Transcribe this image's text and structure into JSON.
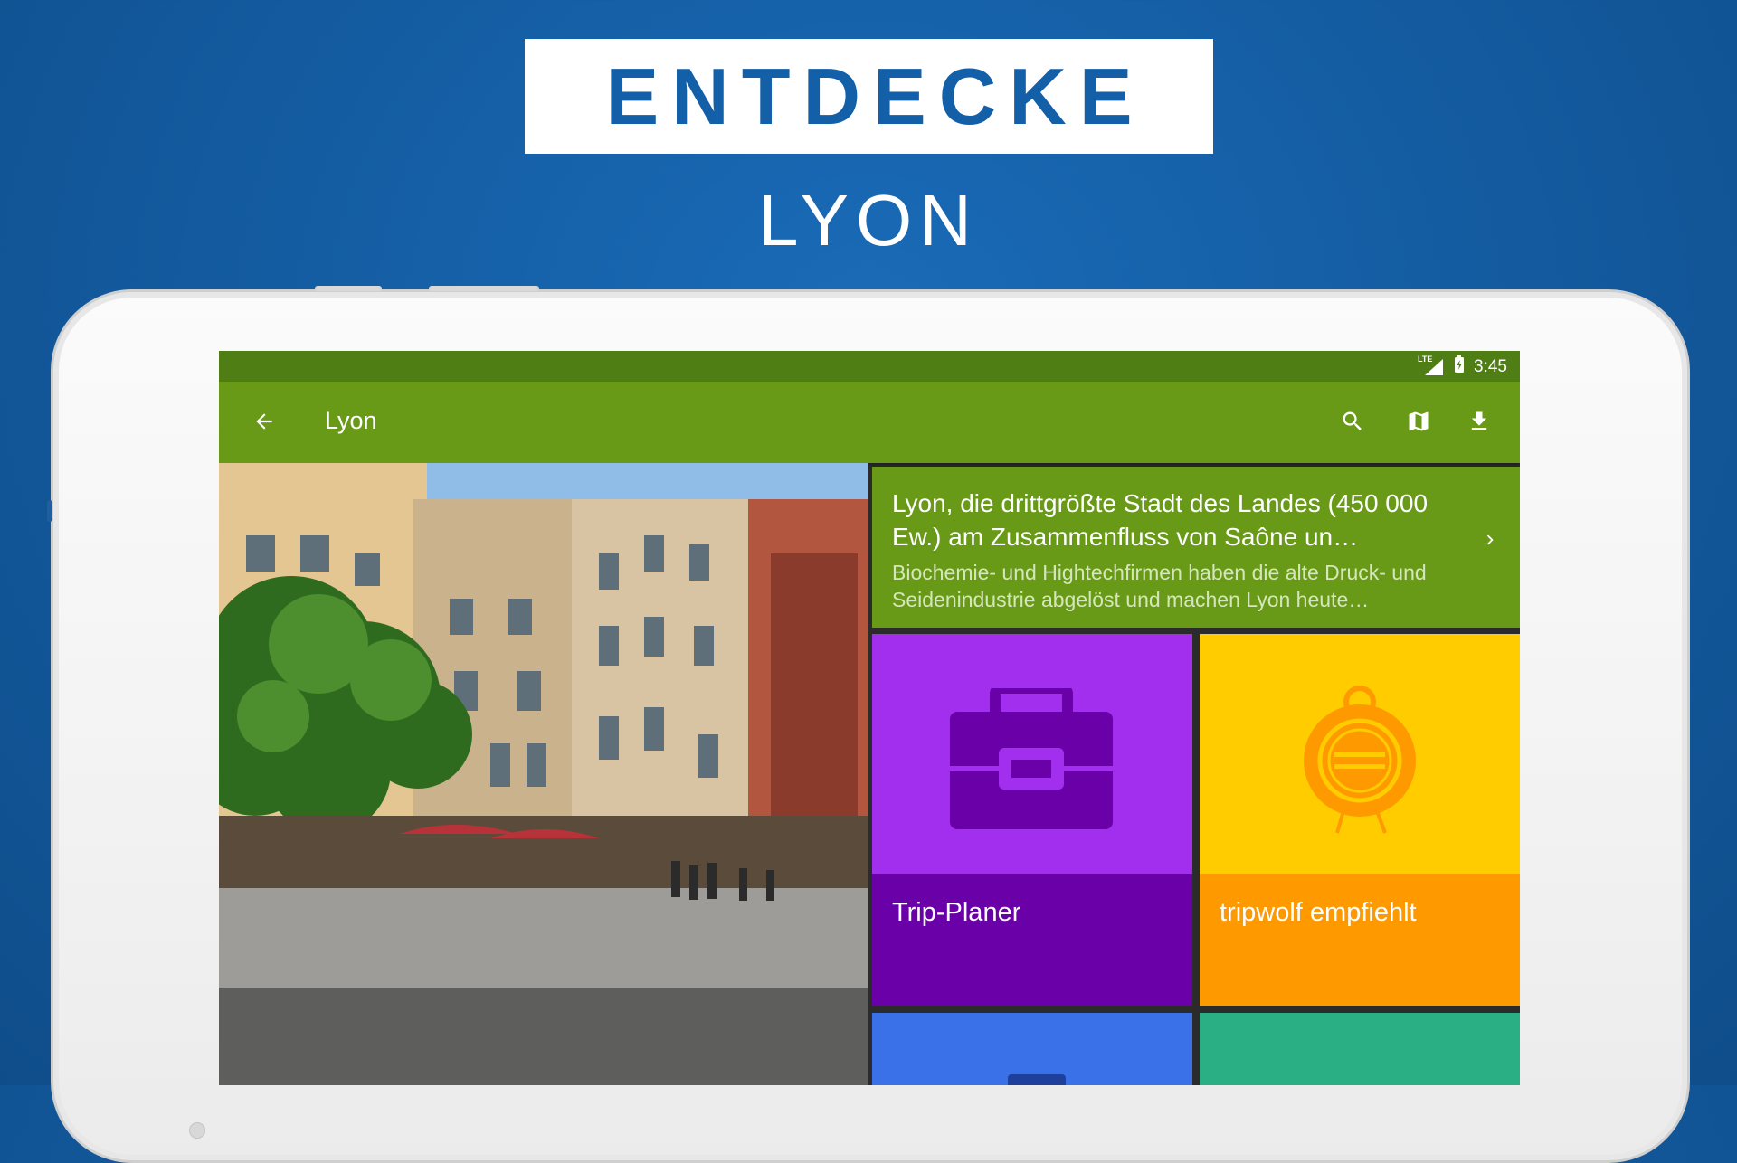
{
  "promo": {
    "headline": "ENTDECKE",
    "city": "LYON"
  },
  "status_bar": {
    "network": "LTE",
    "time": "3:45"
  },
  "toolbar": {
    "title": "Lyon",
    "icons": [
      "back-arrow-icon",
      "search-icon",
      "map-icon",
      "download-icon"
    ]
  },
  "description_card": {
    "title": "Lyon, die drittgrößte Stadt des Landes (450 000 Ew.) am Zusammenfluss von Saône un…",
    "body": "Biochemie- und Hightechfirmen haben die alte Druck- und Seidenindustrie abgelöst und machen Lyon heute…"
  },
  "tiles": [
    {
      "label": "Trip-Planer",
      "icon": "briefcase-icon",
      "color_top": "#a22fee",
      "color_bottom": "#6a00a8"
    },
    {
      "label": "tripwolf empfiehlt",
      "icon": "seal-icon",
      "color_top": "#ffcc00",
      "color_bottom": "#ff9900"
    },
    {
      "label": "",
      "icon": "",
      "color_top": "#3a70e8"
    },
    {
      "label": "",
      "icon": "",
      "color_top": "#2aaf84"
    }
  ],
  "colors": {
    "background": "#135a9e",
    "toolbar": "#689a17",
    "status_bar": "#4f7f14"
  }
}
